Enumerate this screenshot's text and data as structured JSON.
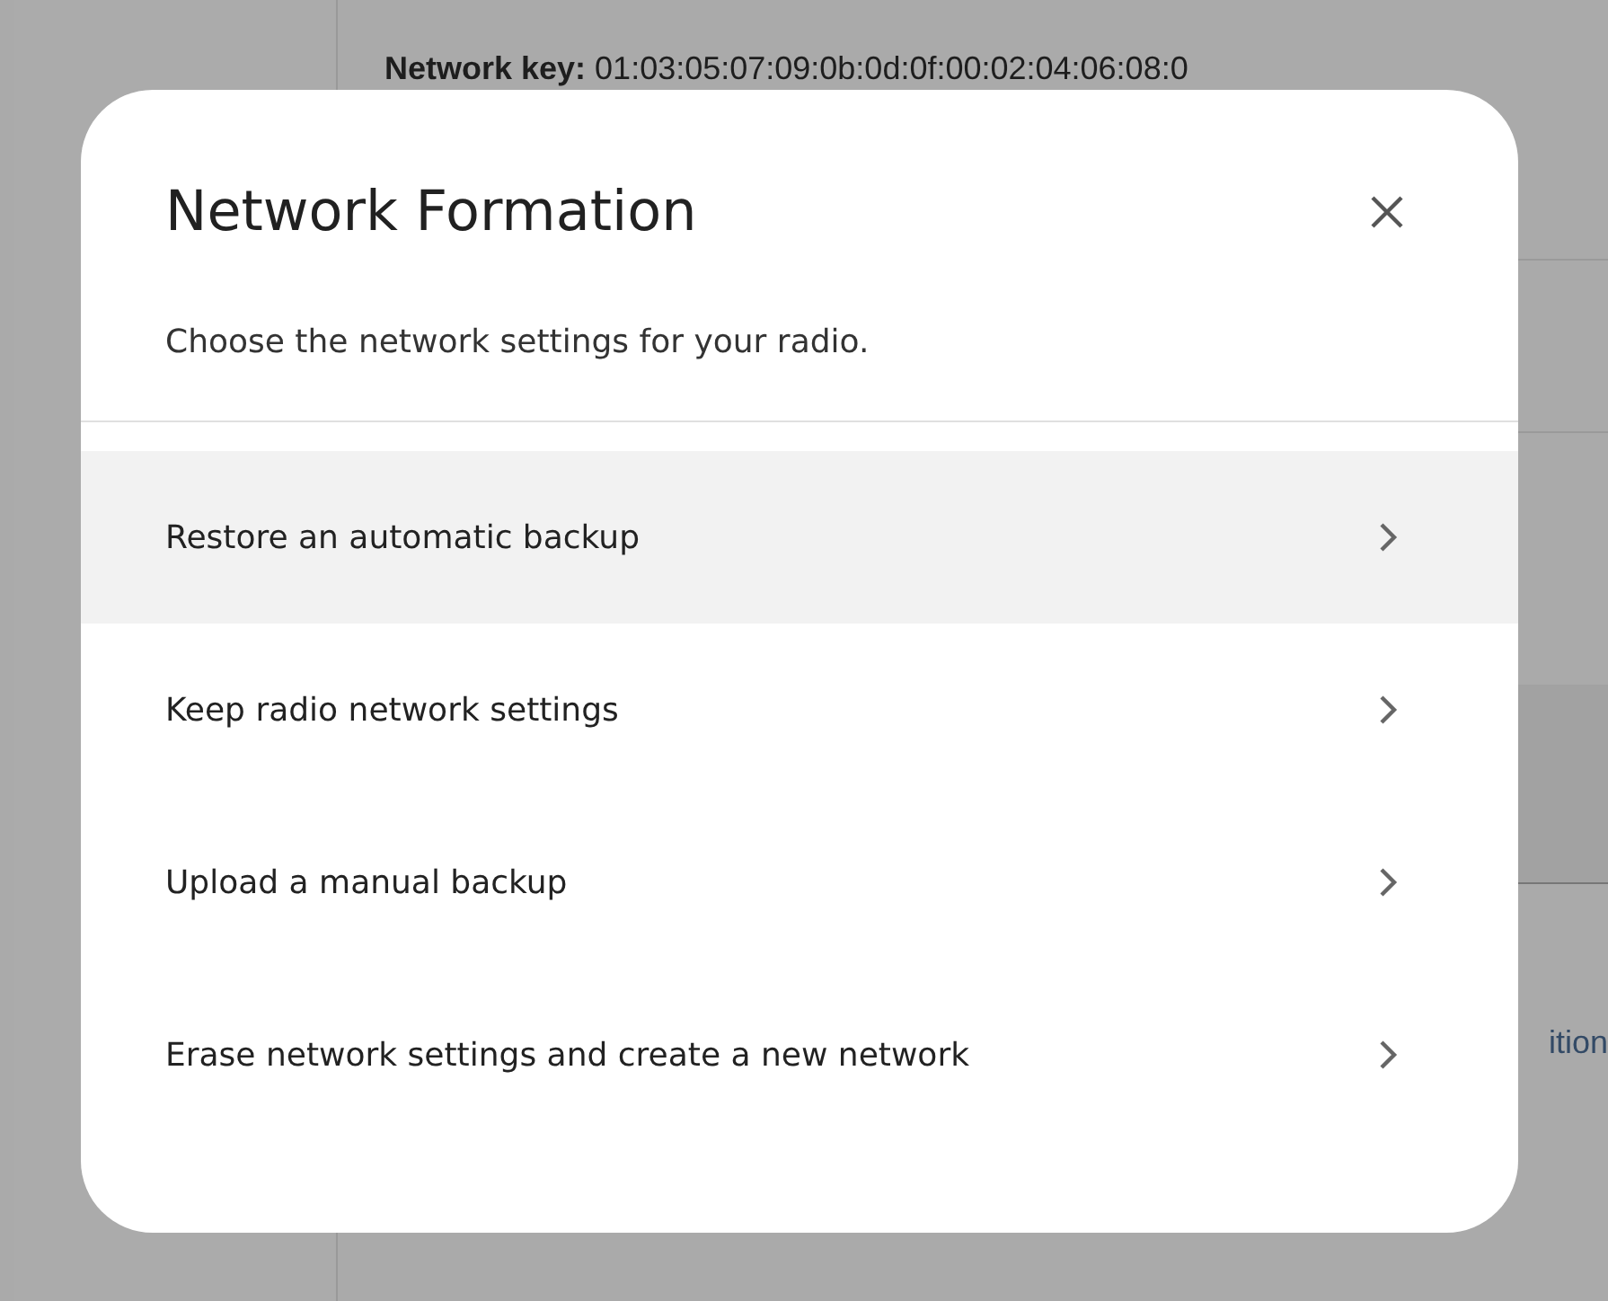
{
  "background": {
    "network_key": {
      "label": "Network key:",
      "value": "01:03:05:07:09:0b:0d:0f:00:02:04:06:08:0"
    },
    "side_text": "ition"
  },
  "dialog": {
    "title": "Network Formation",
    "subtitle": "Choose the network settings for your radio.",
    "options": [
      {
        "label": "Restore an automatic backup",
        "highlighted": true
      },
      {
        "label": "Keep radio network settings",
        "highlighted": false
      },
      {
        "label": "Upload a manual backup",
        "highlighted": false
      },
      {
        "label": "Erase network settings and create a new network",
        "highlighted": false
      }
    ]
  }
}
